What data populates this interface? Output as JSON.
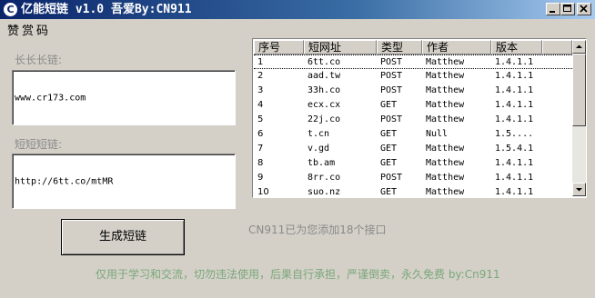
{
  "window": {
    "title": "亿能短链 v1.0 吾爱By:CN911",
    "icon": "app-logo-icon"
  },
  "menu": {
    "item": "赞赏码"
  },
  "long_link": {
    "label": "长长长链:",
    "value": "www.cr173.com"
  },
  "short_link": {
    "label": "短短短链:",
    "value": "http://6tt.co/mtMR"
  },
  "generate_button": "生成短链",
  "table": {
    "columns": [
      "序号",
      "短网址",
      "类型",
      "作者",
      "版本"
    ],
    "rows": [
      [
        "1",
        "6tt.co",
        "POST",
        "Matthew",
        "1.4.1.1"
      ],
      [
        "2",
        "aad.tw",
        "POST",
        "Matthew",
        "1.4.1.1"
      ],
      [
        "3",
        "33h.co",
        "POST",
        "Matthew",
        "1.4.1.1"
      ],
      [
        "4",
        "ecx.cx",
        "GET",
        "Matthew",
        "1.4.1.1"
      ],
      [
        "5",
        "22j.co",
        "POST",
        "Matthew",
        "1.4.1.1"
      ],
      [
        "6",
        "t.cn",
        "GET",
        "Null",
        "1.5...."
      ],
      [
        "7",
        "v.gd",
        "GET",
        "Matthew",
        "1.5.4.1"
      ],
      [
        "8",
        "tb.am",
        "GET",
        "Matthew",
        "1.4.1.1"
      ],
      [
        "9",
        "8rr.co",
        "POST",
        "Matthew",
        "1.4.1.1"
      ],
      [
        "10",
        "suo.nz",
        "GET",
        "Matthew",
        "1.4.1.1"
      ]
    ],
    "selected_row": 1
  },
  "status_text": "CN911已为您添加18个接口",
  "footer_text": "仅用于学习和交流，切勿违法使用，后果自行承担，严谨倒卖，永久免费 by:Cn911",
  "colors": {
    "title_start": "#0a246a",
    "title_end": "#a6caf0",
    "face": "#d4d0c8",
    "footer": "#7aa87a"
  }
}
